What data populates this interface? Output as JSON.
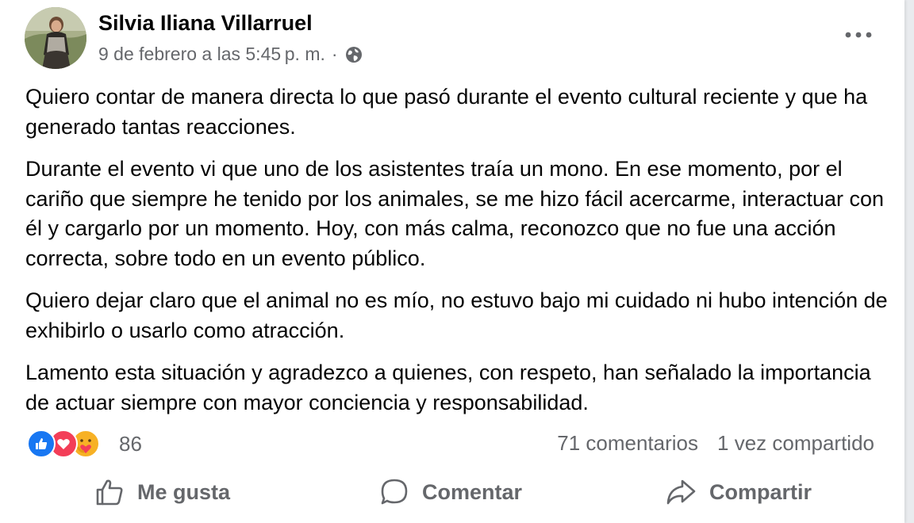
{
  "post": {
    "author": "Silvia Iliana Villarruel",
    "timestamp": "9 de febrero a las 5:45 p. m.",
    "separator": "·",
    "visibility_icon": "globe-icon",
    "paragraphs": [
      "Quiero contar de manera directa lo que pasó durante el evento cultural reciente y que ha generado tantas reacciones.",
      "Durante el evento vi que uno de los asistentes traía un mono. En ese momento, por el cariño que siempre he tenido por los animales, se me hizo fácil acercarme, interactuar con él y cargarlo por un momento. Hoy, con más calma, reconozco que no fue una acción correcta, sobre todo en un evento público.",
      "Quiero dejar claro que el animal no es mío, no estuvo bajo mi cuidado ni hubo intención de exhibirlo o usarlo como atracción.",
      "Lamento esta situación y agradezco a quienes, con respeto, han señalado la importancia de actuar siempre con mayor conciencia y responsabilidad."
    ]
  },
  "reactions": {
    "icons": [
      "like-icon",
      "love-icon",
      "care-icon"
    ],
    "count": "86"
  },
  "stats": {
    "comments": "71 comentarios",
    "shares": "1 vez compartido"
  },
  "actions": {
    "like": "Me gusta",
    "comment": "Comentar",
    "share": "Compartir"
  },
  "colors": {
    "like_blue": "#1877f2",
    "love_red": "#f33e58",
    "care_yellow": "#f7b125",
    "secondary_text": "#65676b"
  }
}
